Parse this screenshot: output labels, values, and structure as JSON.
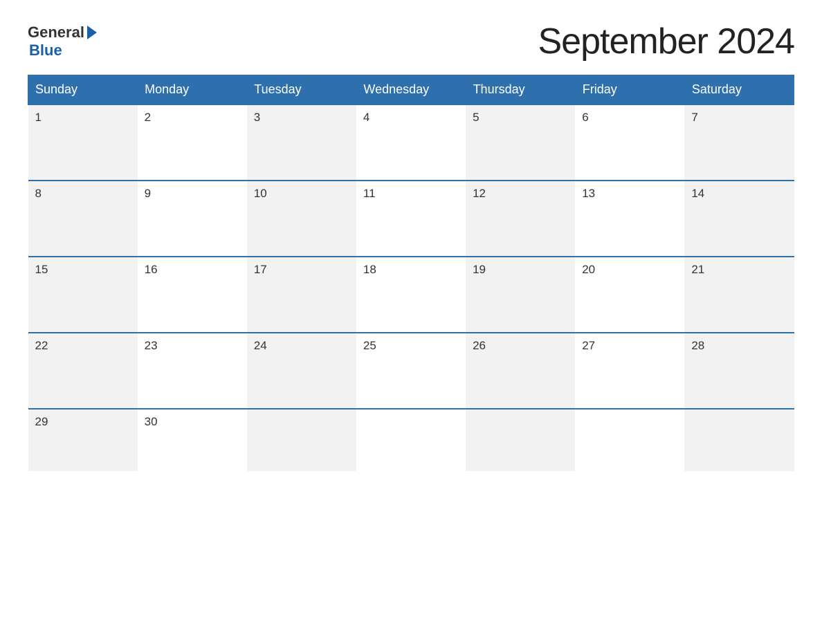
{
  "logo": {
    "general_text": "General",
    "blue_text": "Blue"
  },
  "title": "September 2024",
  "days_of_week": [
    "Sunday",
    "Monday",
    "Tuesday",
    "Wednesday",
    "Thursday",
    "Friday",
    "Saturday"
  ],
  "weeks": [
    [
      {
        "day": "1",
        "shaded": true
      },
      {
        "day": "2",
        "shaded": false
      },
      {
        "day": "3",
        "shaded": true
      },
      {
        "day": "4",
        "shaded": false
      },
      {
        "day": "5",
        "shaded": true
      },
      {
        "day": "6",
        "shaded": false
      },
      {
        "day": "7",
        "shaded": true
      }
    ],
    [
      {
        "day": "8",
        "shaded": true
      },
      {
        "day": "9",
        "shaded": false
      },
      {
        "day": "10",
        "shaded": true
      },
      {
        "day": "11",
        "shaded": false
      },
      {
        "day": "12",
        "shaded": true
      },
      {
        "day": "13",
        "shaded": false
      },
      {
        "day": "14",
        "shaded": true
      }
    ],
    [
      {
        "day": "15",
        "shaded": true
      },
      {
        "day": "16",
        "shaded": false
      },
      {
        "day": "17",
        "shaded": true
      },
      {
        "day": "18",
        "shaded": false
      },
      {
        "day": "19",
        "shaded": true
      },
      {
        "day": "20",
        "shaded": false
      },
      {
        "day": "21",
        "shaded": true
      }
    ],
    [
      {
        "day": "22",
        "shaded": true
      },
      {
        "day": "23",
        "shaded": false
      },
      {
        "day": "24",
        "shaded": true
      },
      {
        "day": "25",
        "shaded": false
      },
      {
        "day": "26",
        "shaded": true
      },
      {
        "day": "27",
        "shaded": false
      },
      {
        "day": "28",
        "shaded": true
      }
    ],
    [
      {
        "day": "29",
        "shaded": true
      },
      {
        "day": "30",
        "shaded": false
      },
      {
        "day": "",
        "shaded": true
      },
      {
        "day": "",
        "shaded": false
      },
      {
        "day": "",
        "shaded": true
      },
      {
        "day": "",
        "shaded": false
      },
      {
        "day": "",
        "shaded": true
      }
    ]
  ]
}
